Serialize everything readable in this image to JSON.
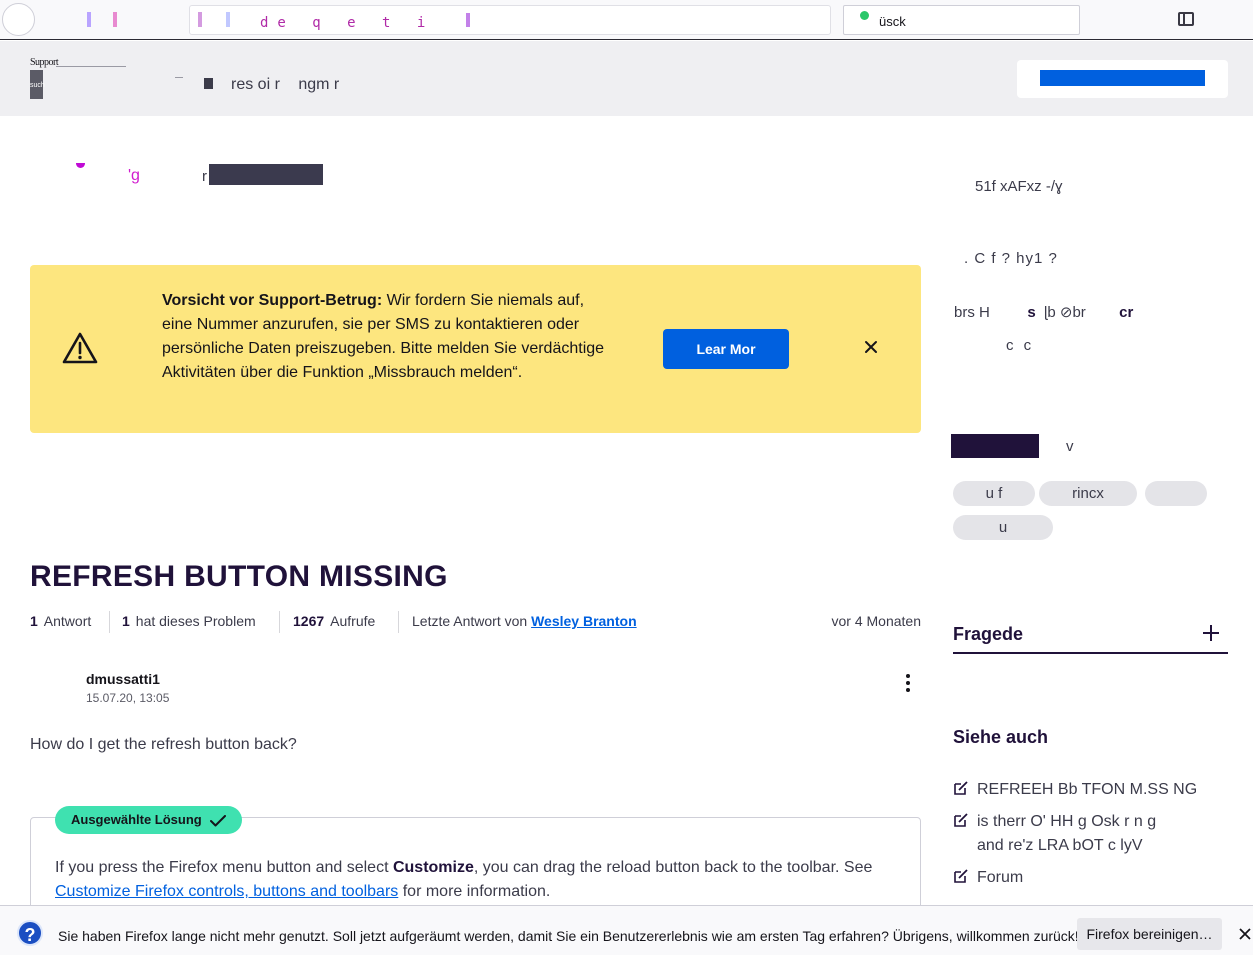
{
  "browser": {
    "url_text": "de q e t i",
    "search_text": "üsck"
  },
  "header": {
    "logo_text": "Support",
    "logo_sub": "such",
    "nav_items": [
      "res oi r",
      "ngm r"
    ]
  },
  "breadcrumb": {
    "mark": "'g",
    "letter": "r"
  },
  "banner": {
    "title": "Vorsicht vor Support-Betrug:",
    "body": " Wir fordern Sie niemals auf, eine Nummer anzurufen, sie per SMS zu kontaktieren oder persönliche Daten preiszugeben. Bitte melden Sie verdächtige Aktivitäten über die Funktion „Missbrauch melden“.",
    "button_label": "Lear   Mor"
  },
  "question": {
    "title": "REFRESH BUTTON MISSING",
    "replies_count": "1",
    "replies_label": "Antwort",
    "problem_count": "1",
    "problem_label": "hat dieses Problem",
    "views_count": "1267",
    "views_label": "Aufrufe",
    "last_reply_label": "Letzte Antwort von",
    "last_reply_author": "Wesley Branton",
    "ago": "vor 4 Monaten",
    "author": "dmussatti1",
    "date": "15.07.20, 13:05",
    "body": "How do I get the refresh button back?"
  },
  "solution": {
    "badge": "Ausgewählte Lösung",
    "text_1": "If you press the Firefox menu button and select ",
    "text_bold": "Customize",
    "text_2": ", you can drag the reload button back to the toolbar. See ",
    "link": "Customize Firefox controls, buttons and toolbars",
    "text_3": " for more information."
  },
  "sidebar": {
    "line1": "51f  xAFxz -/ɣ",
    "line2": ". C f ? hy1  ?",
    "line3_a": "brs  H",
    "line3_b": "s",
    "line3_c": "ɭb  ⊘br",
    "line3_d": "cr",
    "line4": "c c",
    "dropdown_v": "v",
    "pills": [
      "u f",
      "rincx",
      "",
      "u"
    ],
    "fragen_label": "Fragede",
    "siehe_title": "Siehe auch",
    "related": [
      {
        "line1": "REFREEH Bb TFON M.SS NG",
        "line2": ""
      },
      {
        "line1": "is therr  O'     HH  g      Osk r  n  g",
        "line2": "and re'z       LRA  bOT  c   lyV"
      },
      {
        "line1": "Forum",
        "line2": ""
      }
    ]
  },
  "notification": {
    "icon": "?",
    "text": "Sie haben Firefox lange nicht mehr genutzt. Soll jetzt aufgeräumt werden, damit Sie ein Benutzererlebnis wie am ersten Tag erfahren? Übrigens, willkommen zurück!",
    "button": "Firefox bereinigen…"
  },
  "colors": {
    "accent": "#0060df",
    "banner_bg": "#fde67f",
    "solution_badge": "#3fe1b0",
    "title_text": "#20123a"
  }
}
